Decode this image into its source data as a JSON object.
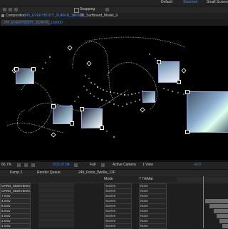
{
  "workspaces": {
    "default": "Default",
    "standard": "Standard",
    "small_screen": "Small Screen"
  },
  "toolbar": {
    "snapping": "Snapping"
  },
  "composition_panel": {
    "prefix": "Composition",
    "comp_name": "24fi_EVERYBODY_SURFIN_150000",
    "tab2": "3D_Surfboard_Model_9"
  },
  "viewer_tab": {
    "label": "24fi_EVERYBODY_SURFIN_150000"
  },
  "viewer_controls": {
    "zoom": "66,7%",
    "timecode": "0:01:27:04",
    "resolution": "Full",
    "camera": "Active Camera",
    "views": "1 View",
    "exposure": "+0,0"
  },
  "bottom_tabs": [
    "Kamp 2",
    "Render Queue",
    "24fi_Fonts_Weiße_12F"
  ],
  "timeline": {
    "mode_header": "Mode",
    "track_header": "T  TrkMat",
    "layers": [
      {
        "name": "OARD_SIDEVIEW.mov",
        "mode": "Screen",
        "trk": "None"
      },
      {
        "name": "OARD_SIDEVIEW.mov",
        "mode": "Screen",
        "trk": "None"
      },
      {
        "name": "7.mov",
        "mode": "Screen",
        "trk": "None"
      },
      {
        "name": "4.mov",
        "mode": "Screen",
        "trk": "None"
      },
      {
        "name": "6.mov",
        "mode": "Screen",
        "trk": "None"
      },
      {
        "name": "5.mov",
        "mode": "Screen",
        "trk": "None"
      },
      {
        "name": "4.mov",
        "mode": "Screen",
        "trk": "None"
      },
      {
        "name": "2.mov",
        "mode": "Screen",
        "trk": "None"
      },
      {
        "name": "1.mov",
        "mode": "Screen",
        "trk": "None"
      }
    ]
  },
  "colors": {
    "accent": "#3d8cf0",
    "selection": "#ffffff"
  }
}
